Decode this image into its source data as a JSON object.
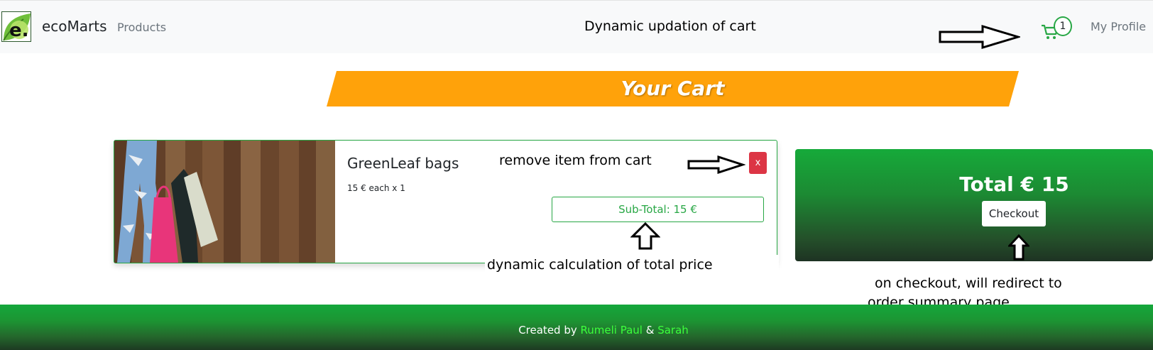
{
  "navbar": {
    "brand": "ecoMarts",
    "logo_letter": "e.",
    "products_label": "Products",
    "cart_count": "1",
    "profile_label": "My Profile"
  },
  "annotations": {
    "top": "Dynamic updation of cart",
    "remove": "remove item from cart",
    "dynamic": "dynamic calculation of total price",
    "checkout": "on checkout, will redirect to order summary page"
  },
  "banner": {
    "title": "Your Cart"
  },
  "cart": {
    "items": [
      {
        "name": "GreenLeaf bags",
        "qty_text": "15 € each x 1",
        "remove_label": "x",
        "subtotal_text": "Sub-Total: 15 €"
      }
    ]
  },
  "summary": {
    "total_text": "Total € 15",
    "checkout_label": "Checkout"
  },
  "footer": {
    "prefix": "Created by ",
    "author1": "Rumeli Paul",
    "separator": " & ",
    "author2": "Sarah"
  },
  "colors": {
    "accent_green": "#28a745",
    "banner_orange": "#ffa20a",
    "remove_red": "#dc3545",
    "author_green": "#3cff3c"
  }
}
